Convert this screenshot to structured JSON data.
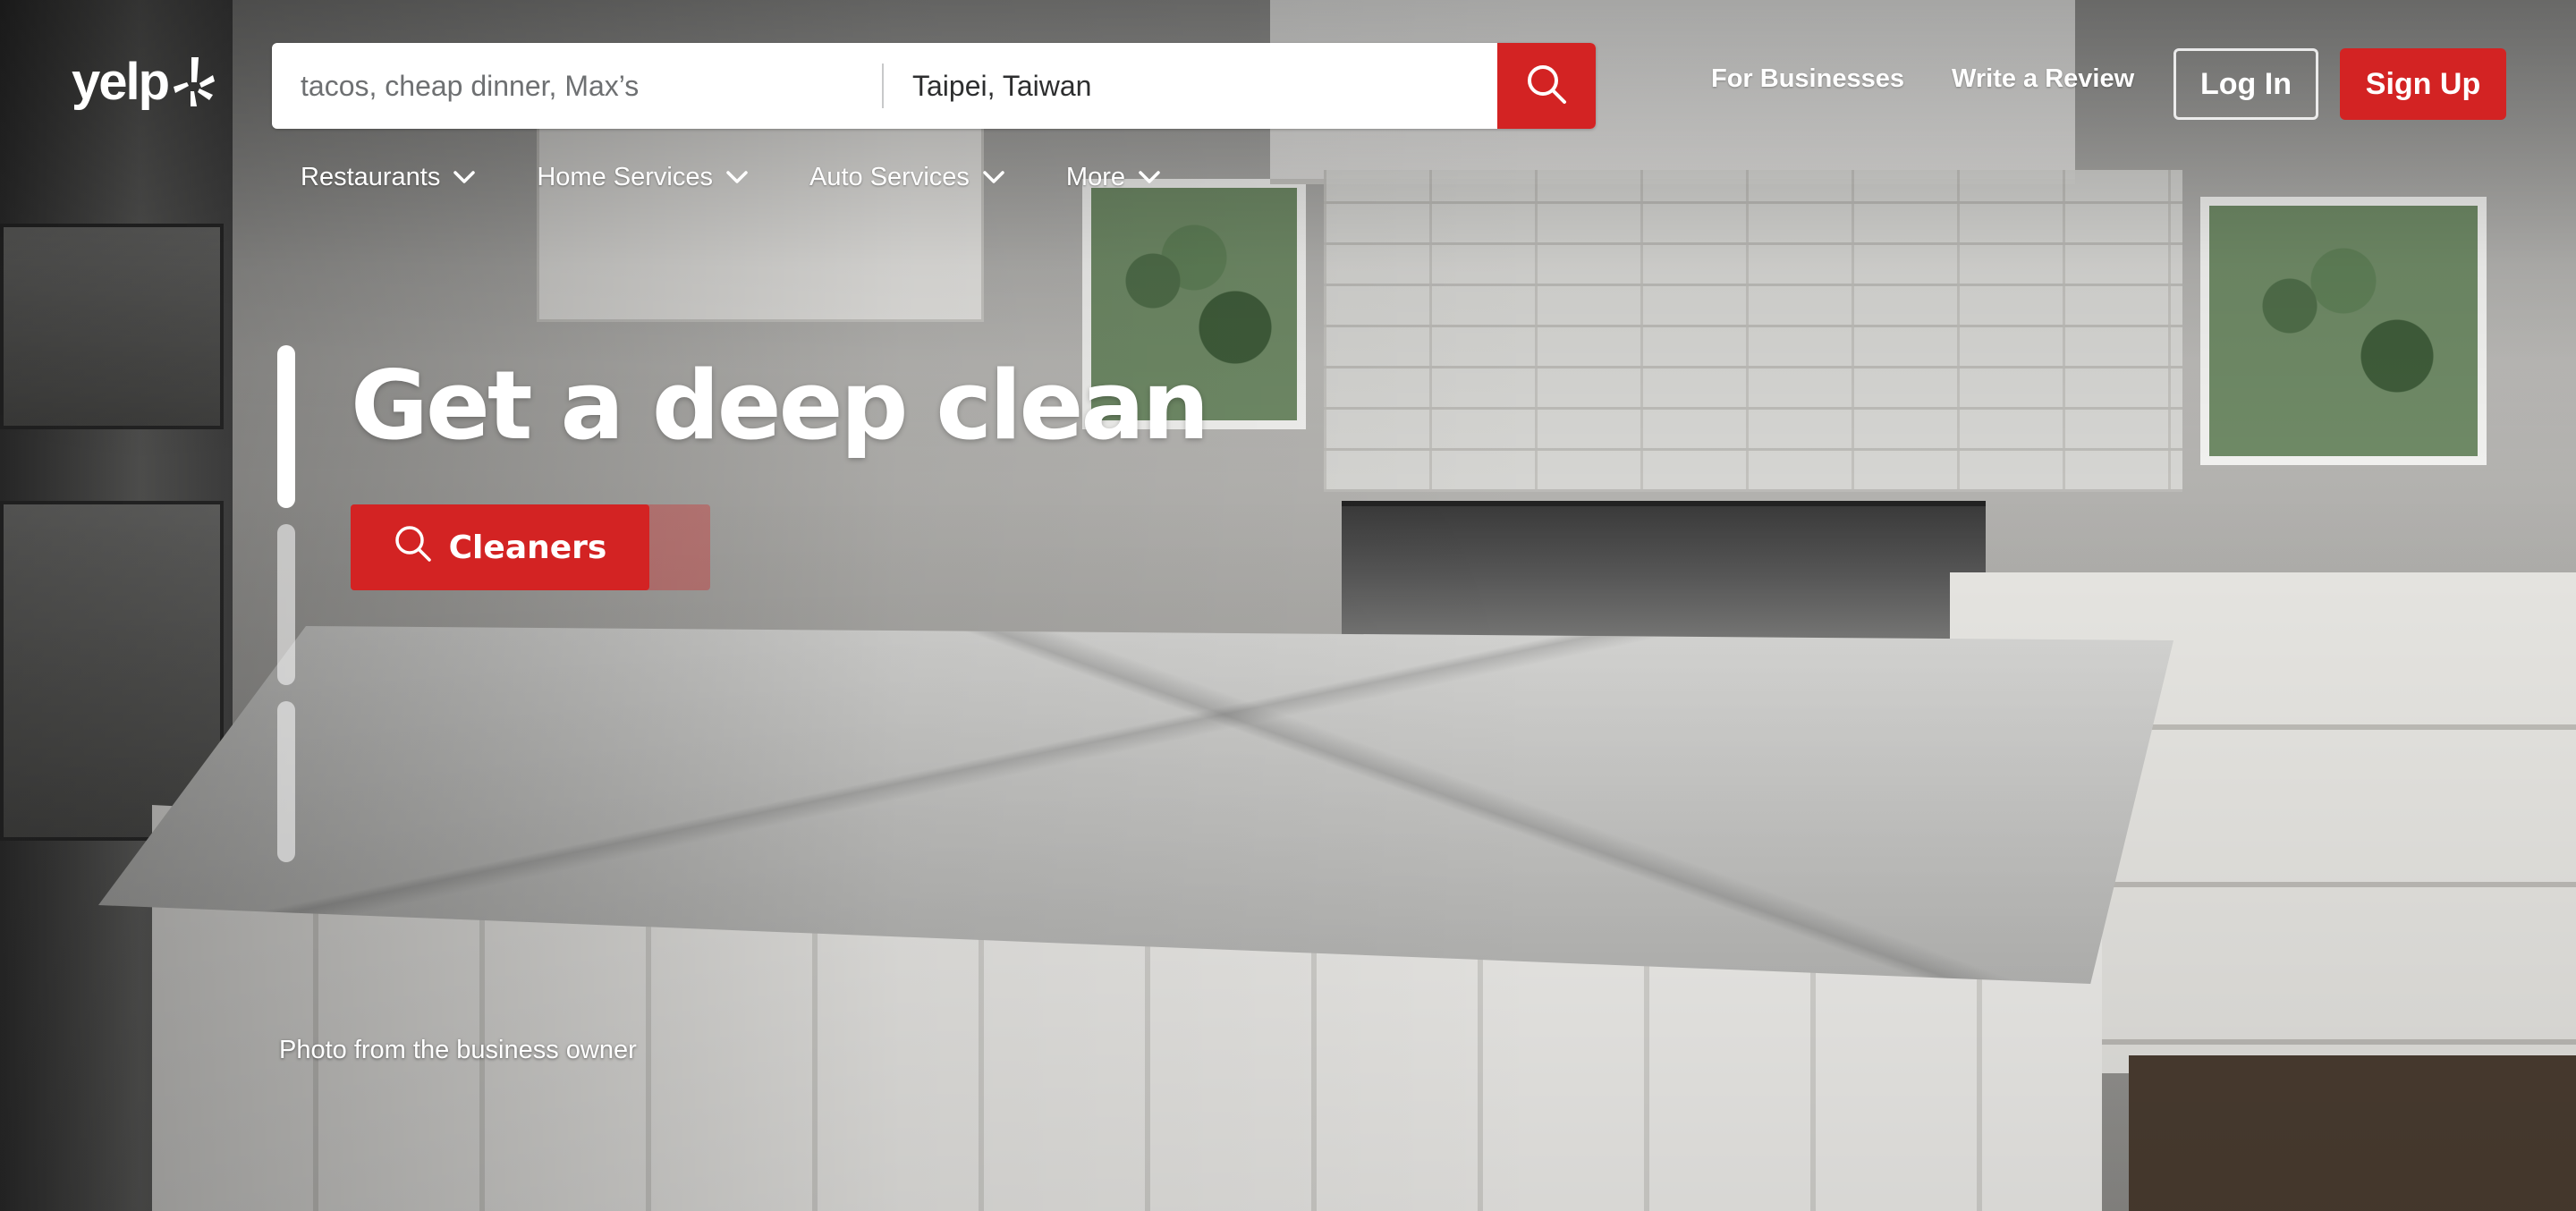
{
  "header": {
    "logo_text": "yelp",
    "search": {
      "find_placeholder": "tacos, cheap dinner, Max’s",
      "near_value": "Taipei, Taiwan"
    },
    "links": {
      "for_businesses": "For Businesses",
      "write_review": "Write a Review"
    },
    "buttons": {
      "login": "Log In",
      "signup": "Sign Up"
    }
  },
  "nav": {
    "categories": [
      {
        "label": "Restaurants"
      },
      {
        "label": "Home Services"
      },
      {
        "label": "Auto Services"
      },
      {
        "label": "More"
      }
    ]
  },
  "hero": {
    "title": "Get a deep clean",
    "cta_label": "Cleaners",
    "photo_credit": "Photo from the business owner",
    "carousel": {
      "count": 3,
      "active_index": 0
    }
  },
  "colors": {
    "brand_red": "#d32323",
    "white": "#ffffff"
  },
  "icons": [
    "yelp-burst-icon",
    "search-icon",
    "chevron-down-icon"
  ]
}
